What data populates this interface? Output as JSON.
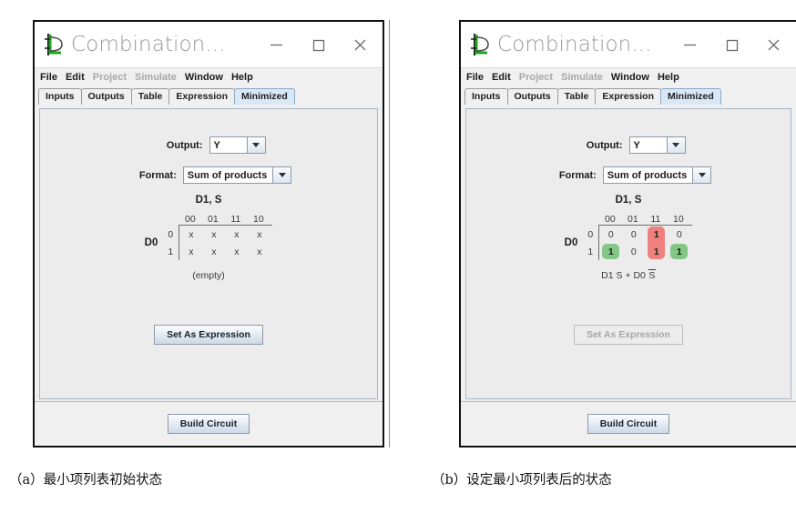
{
  "window": {
    "title": "Combination...",
    "logo_icon": "logisim-gate-icon",
    "controls": {
      "minimize": "minimize-icon",
      "maximize": "maximize-icon",
      "close": "close-icon"
    },
    "menus": [
      {
        "label": "File",
        "enabled": true
      },
      {
        "label": "Edit",
        "enabled": true
      },
      {
        "label": "Project",
        "enabled": false
      },
      {
        "label": "Simulate",
        "enabled": false
      },
      {
        "label": "Window",
        "enabled": true
      },
      {
        "label": "Help",
        "enabled": true
      }
    ],
    "tabs": [
      {
        "label": "Inputs",
        "active": false
      },
      {
        "label": "Outputs",
        "active": false
      },
      {
        "label": "Table",
        "active": false
      },
      {
        "label": "Expression",
        "active": false
      },
      {
        "label": "Minimized",
        "active": true
      }
    ]
  },
  "form": {
    "output_label": "Output:",
    "output_value": "Y",
    "format_label": "Format:",
    "format_value": "Sum of products",
    "dropdown_icon": "chevron-down-icon"
  },
  "kmap": {
    "col_header": "D1, S",
    "row_header": "D0",
    "col_labels": [
      "00",
      "01",
      "11",
      "10"
    ],
    "row_labels": [
      "0",
      "1"
    ]
  },
  "panel_a": {
    "cells": [
      [
        "x",
        "x",
        "x",
        "x"
      ],
      [
        "x",
        "x",
        "x",
        "x"
      ]
    ],
    "expression": "(empty)",
    "expression_overline": "",
    "set_button": "Set As Expression",
    "set_button_enabled": true,
    "build_button": "Build Circuit"
  },
  "panel_b": {
    "cells": [
      [
        "0",
        "0",
        "1",
        "0"
      ],
      [
        "1",
        "0",
        "1",
        "1"
      ]
    ],
    "highlights": [
      {
        "color": "#f08080",
        "name": "implicant-red",
        "col": 2,
        "row": 0,
        "rowspan": 2,
        "colspan": 1
      },
      {
        "color": "#82c785",
        "name": "implicant-green-left",
        "col": 0,
        "row": 1,
        "rowspan": 1,
        "colspan": 1
      },
      {
        "color": "#f08080",
        "name": "implicant-red-lower",
        "col": 2,
        "row": 1,
        "rowspan": 1,
        "colspan": 1
      },
      {
        "color": "#82c785",
        "name": "implicant-green-right",
        "col": 3,
        "row": 1,
        "rowspan": 1,
        "colspan": 1
      }
    ],
    "expression_pre": "D1 S + D0 ",
    "expression_overline": "S",
    "expression_full": "D1 S + D0 S̅",
    "set_button": "Set As Expression",
    "set_button_enabled": false,
    "build_button": "Build Circuit"
  },
  "captions": {
    "a": "（a）最小项列表初始状态",
    "b": "（b）设定最小项列表后的状态"
  },
  "colors": {
    "highlight_red": "#f08080",
    "highlight_green": "#82c785",
    "active_tab": "#d9e8f7"
  }
}
